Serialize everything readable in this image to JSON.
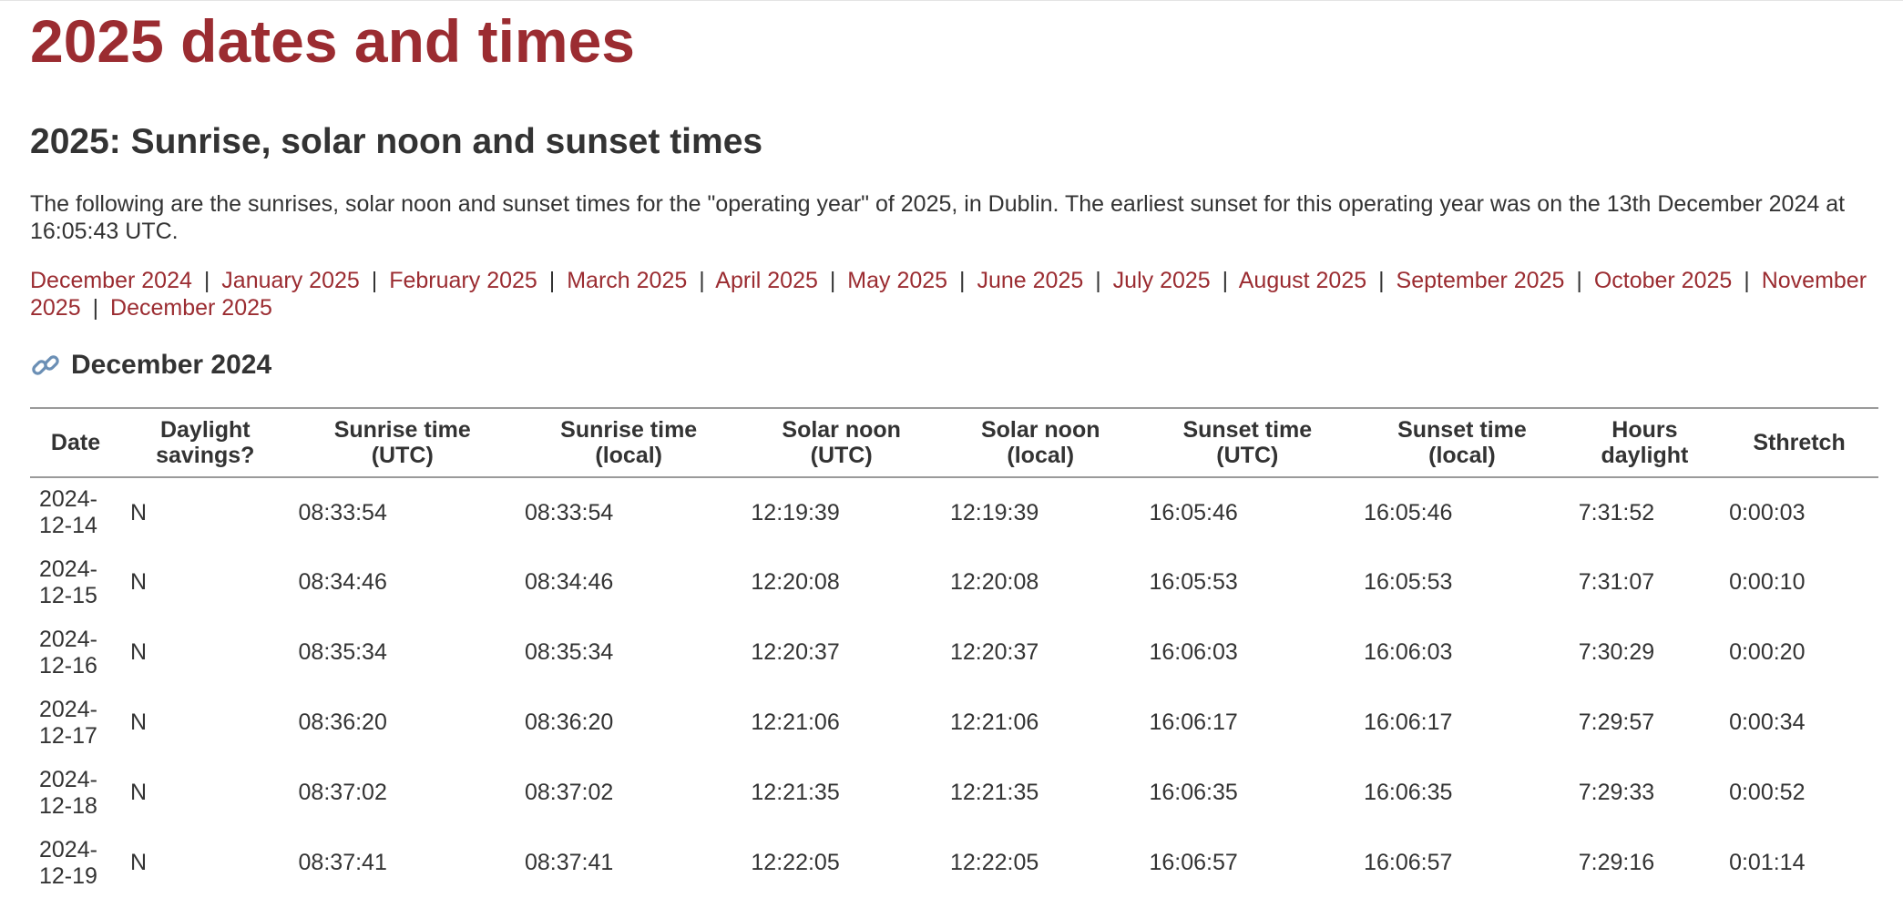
{
  "page": {
    "title": "2025 dates and times",
    "section_title": "2025: Sunrise, solar noon and sunset times",
    "intro": "The following are the sunrises, solar noon and sunset times for the \"operating year\" of 2025, in Dublin. The earliest sunset for this operating year was on the 13th December 2024 at 16:05:43 UTC."
  },
  "month_links": [
    "December 2024",
    "January 2025",
    "February 2025",
    "March 2025",
    "April 2025",
    "May 2025",
    "June 2025",
    "July 2025",
    "August 2025",
    "September 2025",
    "October 2025",
    "November 2025",
    "December 2025"
  ],
  "month_separator": "|",
  "current_month": {
    "icon": "link-icon",
    "heading": "December 2024"
  },
  "table": {
    "headers": [
      [
        "Date"
      ],
      [
        "Daylight",
        "savings?"
      ],
      [
        "Sunrise time",
        "(UTC)"
      ],
      [
        "Sunrise time",
        "(local)"
      ],
      [
        "Solar noon",
        "(UTC)"
      ],
      [
        "Solar noon",
        "(local)"
      ],
      [
        "Sunset time",
        "(UTC)"
      ],
      [
        "Sunset time",
        "(local)"
      ],
      [
        "Hours",
        "daylight"
      ],
      [
        "Sthretch"
      ]
    ],
    "rows": [
      [
        "2024-12-14",
        "N",
        "08:33:54",
        "08:33:54",
        "12:19:39",
        "12:19:39",
        "16:05:46",
        "16:05:46",
        "7:31:52",
        "0:00:03"
      ],
      [
        "2024-12-15",
        "N",
        "08:34:46",
        "08:34:46",
        "12:20:08",
        "12:20:08",
        "16:05:53",
        "16:05:53",
        "7:31:07",
        "0:00:10"
      ],
      [
        "2024-12-16",
        "N",
        "08:35:34",
        "08:35:34",
        "12:20:37",
        "12:20:37",
        "16:06:03",
        "16:06:03",
        "7:30:29",
        "0:00:20"
      ],
      [
        "2024-12-17",
        "N",
        "08:36:20",
        "08:36:20",
        "12:21:06",
        "12:21:06",
        "16:06:17",
        "16:06:17",
        "7:29:57",
        "0:00:34"
      ],
      [
        "2024-12-18",
        "N",
        "08:37:02",
        "08:37:02",
        "12:21:35",
        "12:21:35",
        "16:06:35",
        "16:06:35",
        "7:29:33",
        "0:00:52"
      ],
      [
        "2024-12-19",
        "N",
        "08:37:41",
        "08:37:41",
        "12:22:05",
        "12:22:05",
        "16:06:57",
        "16:06:57",
        "7:29:16",
        "0:01:14"
      ]
    ]
  },
  "colors": {
    "title": "#9b2c31",
    "link": "#9b2c31",
    "text": "#333333",
    "rule": "#9a9a9a",
    "icon": "#6b8fb5"
  }
}
